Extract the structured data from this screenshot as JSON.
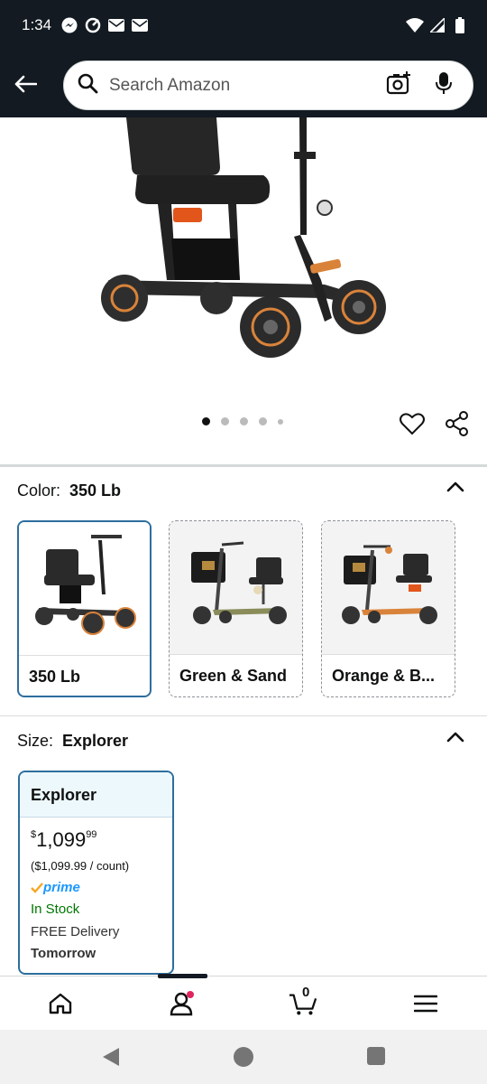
{
  "status_bar": {
    "time": "1:34",
    "left_icons": [
      "messenger-icon",
      "sync-icon",
      "mail-icon",
      "mail-icon"
    ],
    "right_icons": [
      "wifi-icon",
      "signal-icon",
      "battery-icon"
    ]
  },
  "header": {
    "search_placeholder": "Search Amazon",
    "bg_color": "#131a22"
  },
  "gallery": {
    "dot_count": 5,
    "active_dot": 1
  },
  "color_section": {
    "label": "Color:",
    "selected_value": "350 Lb",
    "options": [
      {
        "label": "350 Lb",
        "selected": true
      },
      {
        "label": "Green & Sand",
        "selected": false
      },
      {
        "label": "Orange & B...",
        "selected": false
      }
    ]
  },
  "size_section": {
    "label": "Size:",
    "selected_value": "Explorer",
    "card": {
      "title": "Explorer",
      "currency": "$",
      "price_whole": "1,099",
      "price_fraction": "99",
      "per_unit": "($1,099.99 / count)",
      "prime_label": "prime",
      "stock": "In Stock",
      "delivery": "FREE Delivery",
      "delivery_day": "Tomorrow"
    }
  },
  "bottom_nav": {
    "items": [
      "home-icon",
      "account-icon",
      "cart-icon",
      "menu-icon"
    ],
    "cart_count": "0",
    "active_index": 1
  },
  "colors": {
    "selected_border": "#2d6e9e",
    "in_stock": "#007600",
    "prime_blue": "#1a98ff"
  }
}
